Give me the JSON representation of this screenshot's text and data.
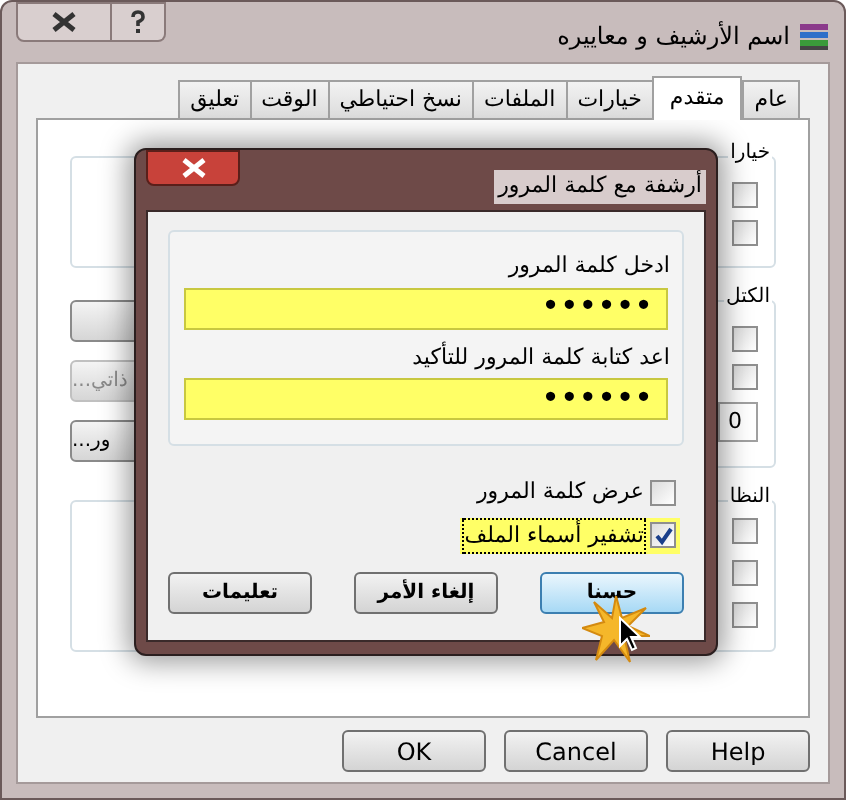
{
  "window": {
    "title": "اسم الأرشيف و معاييره"
  },
  "tabs": [
    {
      "label": "عام",
      "selected": false
    },
    {
      "label": "متقدم",
      "selected": true
    },
    {
      "label": "خيارات",
      "selected": false
    },
    {
      "label": "الملفات",
      "selected": false
    },
    {
      "label": "نسخ احتياطي",
      "selected": false
    },
    {
      "label": "الوقت",
      "selected": false
    },
    {
      "label": "تعليق",
      "selected": false
    }
  ],
  "panel": {
    "top_group": {
      "label": "خيارا",
      "checkboxes": [
        {
          "checked": false
        },
        {
          "checked": false
        }
      ]
    },
    "left_buttons": [
      {
        "disabled": false
      },
      {
        "label": "ذاتي...",
        "disabled": true
      },
      {
        "label": "ور...",
        "disabled": false
      }
    ],
    "block_group": {
      "label": "الكتل",
      "checkboxes": [
        {
          "checked": false
        },
        {
          "checked": false
        }
      ],
      "field_value": "0"
    },
    "lower_group": {
      "label": "النظا",
      "checkboxes": [
        {
          "checked": false
        },
        {
          "checked": false
        },
        {
          "checked": false
        }
      ]
    }
  },
  "buttons": [
    "Help",
    "Cancel",
    "OK"
  ],
  "dialog": {
    "title": "أرشفة مع كلمة المرور",
    "fields": [
      {
        "label": "ادخل كلمة المرور",
        "value": "••••••"
      },
      {
        "label": "اعد كتابة كلمة المرور للتأكيد",
        "value": "••••••"
      }
    ],
    "options": [
      {
        "label": "عرض كلمة المرور",
        "checked": false,
        "focused": false
      },
      {
        "label": "تشفير أسماء الملف",
        "checked": true,
        "focused": true
      }
    ],
    "buttons": [
      {
        "label": "حسنا",
        "default": true
      },
      {
        "label": "إلغاء الأمر",
        "default": false
      },
      {
        "label": "تعليمات",
        "default": false
      }
    ]
  }
}
